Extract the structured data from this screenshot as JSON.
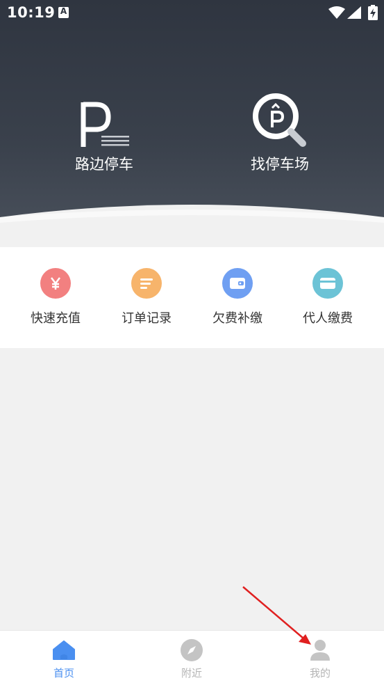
{
  "status_bar": {
    "time": "10:19",
    "notification_icon_letter": "A"
  },
  "features": [
    {
      "label": "路边停车",
      "icon": "roadside-parking-icon"
    },
    {
      "label": "找停车场",
      "icon": "find-parking-lot-icon"
    }
  ],
  "quick_actions": [
    {
      "label": "快速充值",
      "icon": "yen-icon",
      "color": "#f28080"
    },
    {
      "label": "订单记录",
      "icon": "list-icon",
      "color": "#f7b46b"
    },
    {
      "label": "欠费补缴",
      "icon": "wallet-icon",
      "color": "#6f9ff2"
    },
    {
      "label": "代人缴费",
      "icon": "card-icon",
      "color": "#6cc3d6"
    }
  ],
  "tabs": [
    {
      "label": "首页",
      "icon": "home-icon",
      "active": true
    },
    {
      "label": "附近",
      "icon": "compass-icon",
      "active": false
    },
    {
      "label": "我的",
      "icon": "person-icon",
      "active": false
    }
  ],
  "colors": {
    "header": "#2f3540",
    "active_tab": "#4a8ff0",
    "inactive_tab": "#b5b5b5",
    "annotation_arrow": "#e02020"
  }
}
